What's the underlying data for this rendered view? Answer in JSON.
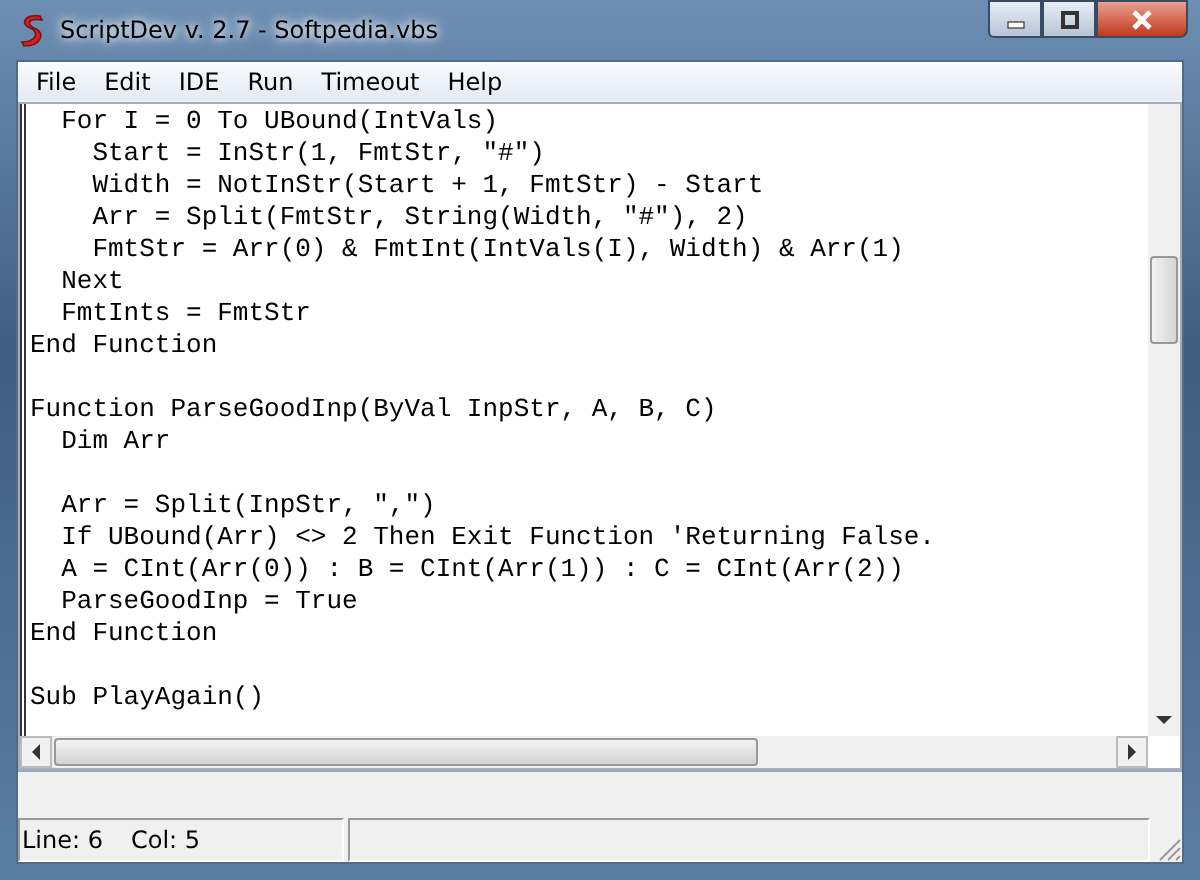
{
  "window": {
    "title": "ScriptDev v. 2.7 - Softpedia.vbs"
  },
  "menu": [
    "File",
    "Edit",
    "IDE",
    "Run",
    "Timeout",
    "Help"
  ],
  "editor": {
    "code": "  For I = 0 To UBound(IntVals)\n    Start = InStr(1, FmtStr, \"#\")\n    Width = NotInStr(Start + 1, FmtStr) - Start\n    Arr = Split(FmtStr, String(Width, \"#\"), 2)\n    FmtStr = Arr(0) & FmtInt(IntVals(I), Width) & Arr(1)\n  Next\n  FmtInts = FmtStr\nEnd Function\n\nFunction ParseGoodInp(ByVal InpStr, A, B, C)\n  Dim Arr\n\n  Arr = Split(InpStr, \",\")\n  If UBound(Arr) <> 2 Then Exit Function 'Returning False.\n  A = CInt(Arr(0)) : B = CInt(Arr(1)) : C = CInt(Arr(2))\n  ParseGoodInp = True\nEnd Function\n\nSub PlayAgain()"
  },
  "status_bar": {
    "line": "Line: 6",
    "col": "Col: 5"
  }
}
